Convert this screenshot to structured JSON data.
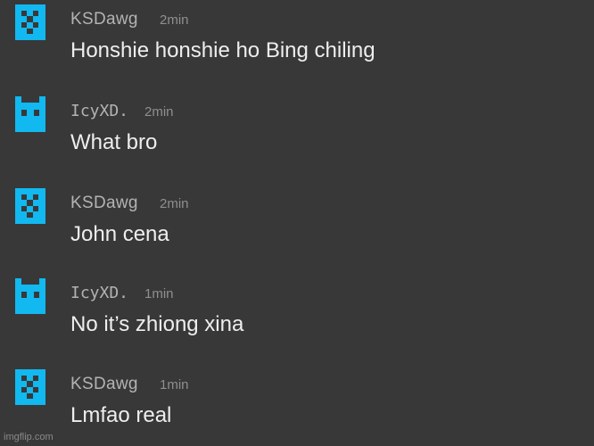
{
  "theme": {
    "background": "#383838",
    "avatar_color": "#12b8f0",
    "username_color": "#b3b3b3",
    "time_color": "#8f8f8f",
    "text_color": "#eeeeee"
  },
  "messages": [
    {
      "user": "KSDawg",
      "time": "2min",
      "text": "Honshie honshie ho Bing chiling",
      "avatar": "checker-pixel-icon"
    },
    {
      "user": "IcyXD.",
      "time": "2min",
      "text": "What bro",
      "avatar": "pixel-cat-icon"
    },
    {
      "user": "KSDawg",
      "time": "2min",
      "text": "John cena",
      "avatar": "checker-pixel-icon"
    },
    {
      "user": "IcyXD.",
      "time": "1min",
      "text": "No it’s zhiong xina",
      "avatar": "pixel-cat-icon"
    },
    {
      "user": "KSDawg",
      "time": "1min",
      "text": "Lmfao real",
      "avatar": "checker-pixel-icon"
    }
  ],
  "watermark": "imgflip.com"
}
